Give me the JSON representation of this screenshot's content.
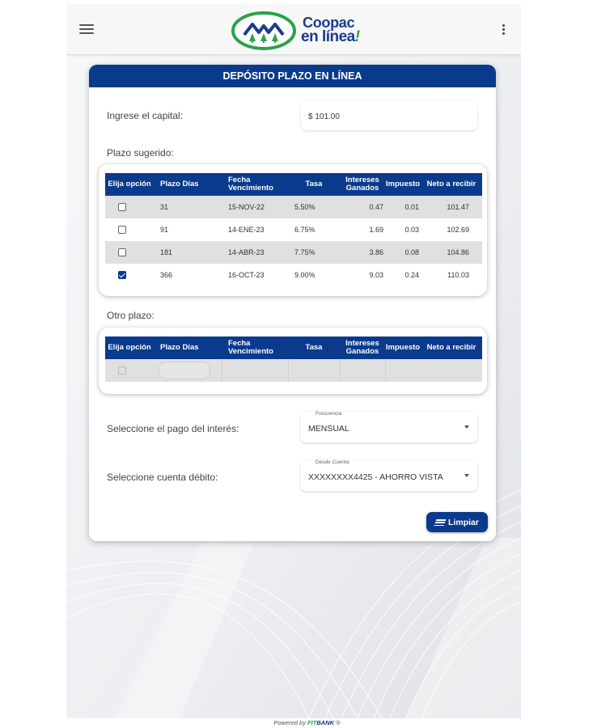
{
  "header": {
    "logo_line1": "Coopac",
    "logo_line2": "en línea",
    "logo_excl": "!"
  },
  "card": {
    "title": "DEPÓSITO PLAZO EN LÍNEA",
    "capital_label": "Ingrese el capital:",
    "capital_value": "$ 101.00",
    "plazo_sugerido_label": "Plazo sugerido:",
    "otro_plazo_label": "Otro plazo:",
    "columns": {
      "elija": "Elija opción",
      "plazo": "Plazo Días",
      "fecha": "Fecha Vencimiento",
      "tasa": "Tasa",
      "intereses": "Intereses Ganados",
      "impuesto": "Impuesto",
      "neto": "Neto a recibir"
    },
    "rows": [
      {
        "dias": "31",
        "fecha": "15-NOV-22",
        "tasa": "5.50%",
        "intereses": "0.47",
        "impuesto": "0.01",
        "neto": "101.47",
        "checked": false
      },
      {
        "dias": "91",
        "fecha": "14-ENE-23",
        "tasa": "6.75%",
        "intereses": "1.69",
        "impuesto": "0.03",
        "neto": "102.69",
        "checked": false
      },
      {
        "dias": "181",
        "fecha": "14-ABR-23",
        "tasa": "7.75%",
        "intereses": "3.86",
        "impuesto": "0.08",
        "neto": "104.86",
        "checked": false
      },
      {
        "dias": "366",
        "fecha": "16-OCT-23",
        "tasa": "9.00%",
        "intereses": "9.03",
        "impuesto": "0.24",
        "neto": "110.03",
        "checked": true
      }
    ],
    "pago_label": "Seleccione el pago del interés:",
    "frecuencia_small": "Frecuencia",
    "frecuencia_value": "MENSUAL",
    "cuenta_label": "Seleccione cuenta débito:",
    "cuenta_small": "Desde Cuenta",
    "cuenta_value": "XXXXXXXX4425 - AHORRO VISTA",
    "limpiar_label": "Limpiar"
  },
  "footer": {
    "powered": "Powered by ",
    "fit": "FIT",
    "bank": "BANK",
    "reg": " ®"
  },
  "colors": {
    "primary": "#0a3a8c",
    "accent_green": "#2aa24a"
  }
}
